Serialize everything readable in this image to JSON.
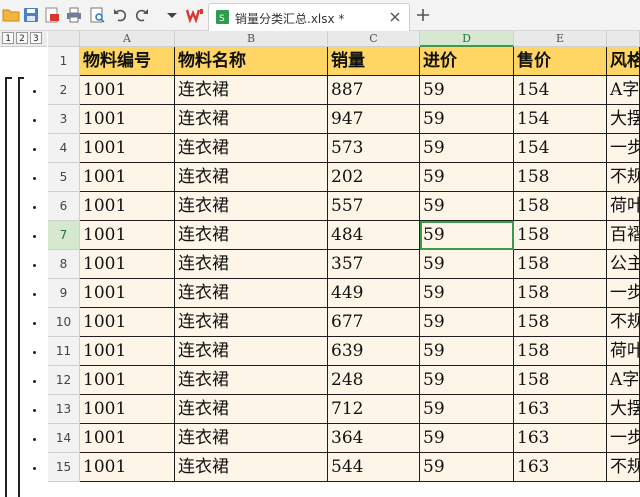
{
  "toolbar": {
    "icons": [
      "open-folder-icon",
      "save-icon",
      "export-pdf-icon",
      "print-icon",
      "print-preview-icon",
      "undo-icon",
      "redo-icon",
      "more-dropdown-icon",
      "wps-logo-icon"
    ]
  },
  "tab": {
    "title": "销量分类汇总.xlsx *"
  },
  "outline": {
    "levels": [
      "1",
      "2",
      "3"
    ]
  },
  "columns": [
    "A",
    "B",
    "C",
    "D",
    "E",
    ""
  ],
  "active_column": "D",
  "active_row": "7",
  "rows": [
    {
      "num": "1",
      "cells": [
        "物料编号",
        "物料名称",
        "销量",
        "进价",
        "售价",
        "风格"
      ]
    },
    {
      "num": "2",
      "cells": [
        "1001",
        "连衣裙",
        "887",
        "59",
        "154",
        "A字"
      ]
    },
    {
      "num": "3",
      "cells": [
        "1001",
        "连衣裙",
        "947",
        "59",
        "154",
        "大摆"
      ]
    },
    {
      "num": "4",
      "cells": [
        "1001",
        "连衣裙",
        "573",
        "59",
        "154",
        "一步"
      ]
    },
    {
      "num": "5",
      "cells": [
        "1001",
        "连衣裙",
        "202",
        "59",
        "158",
        "不规"
      ]
    },
    {
      "num": "6",
      "cells": [
        "1001",
        "连衣裙",
        "557",
        "59",
        "158",
        "荷叶"
      ]
    },
    {
      "num": "7",
      "cells": [
        "1001",
        "连衣裙",
        "484",
        "59",
        "158",
        "百褶"
      ]
    },
    {
      "num": "8",
      "cells": [
        "1001",
        "连衣裙",
        "357",
        "59",
        "158",
        "公主"
      ]
    },
    {
      "num": "9",
      "cells": [
        "1001",
        "连衣裙",
        "449",
        "59",
        "158",
        "一步"
      ]
    },
    {
      "num": "10",
      "cells": [
        "1001",
        "连衣裙",
        "677",
        "59",
        "158",
        "不规"
      ]
    },
    {
      "num": "11",
      "cells": [
        "1001",
        "连衣裙",
        "639",
        "59",
        "158",
        "荷叶"
      ]
    },
    {
      "num": "12",
      "cells": [
        "1001",
        "连衣裙",
        "248",
        "59",
        "158",
        "A字"
      ]
    },
    {
      "num": "13",
      "cells": [
        "1001",
        "连衣裙",
        "712",
        "59",
        "163",
        "大摆"
      ]
    },
    {
      "num": "14",
      "cells": [
        "1001",
        "连衣裙",
        "364",
        "59",
        "163",
        "一步"
      ]
    },
    {
      "num": "15",
      "cells": [
        "1001",
        "连衣裙",
        "544",
        "59",
        "163",
        "不规"
      ]
    }
  ],
  "colors": {
    "header_fill": "#ffd563",
    "cell_fill": "#fdf5e8",
    "selection": "#3c9a4a"
  }
}
